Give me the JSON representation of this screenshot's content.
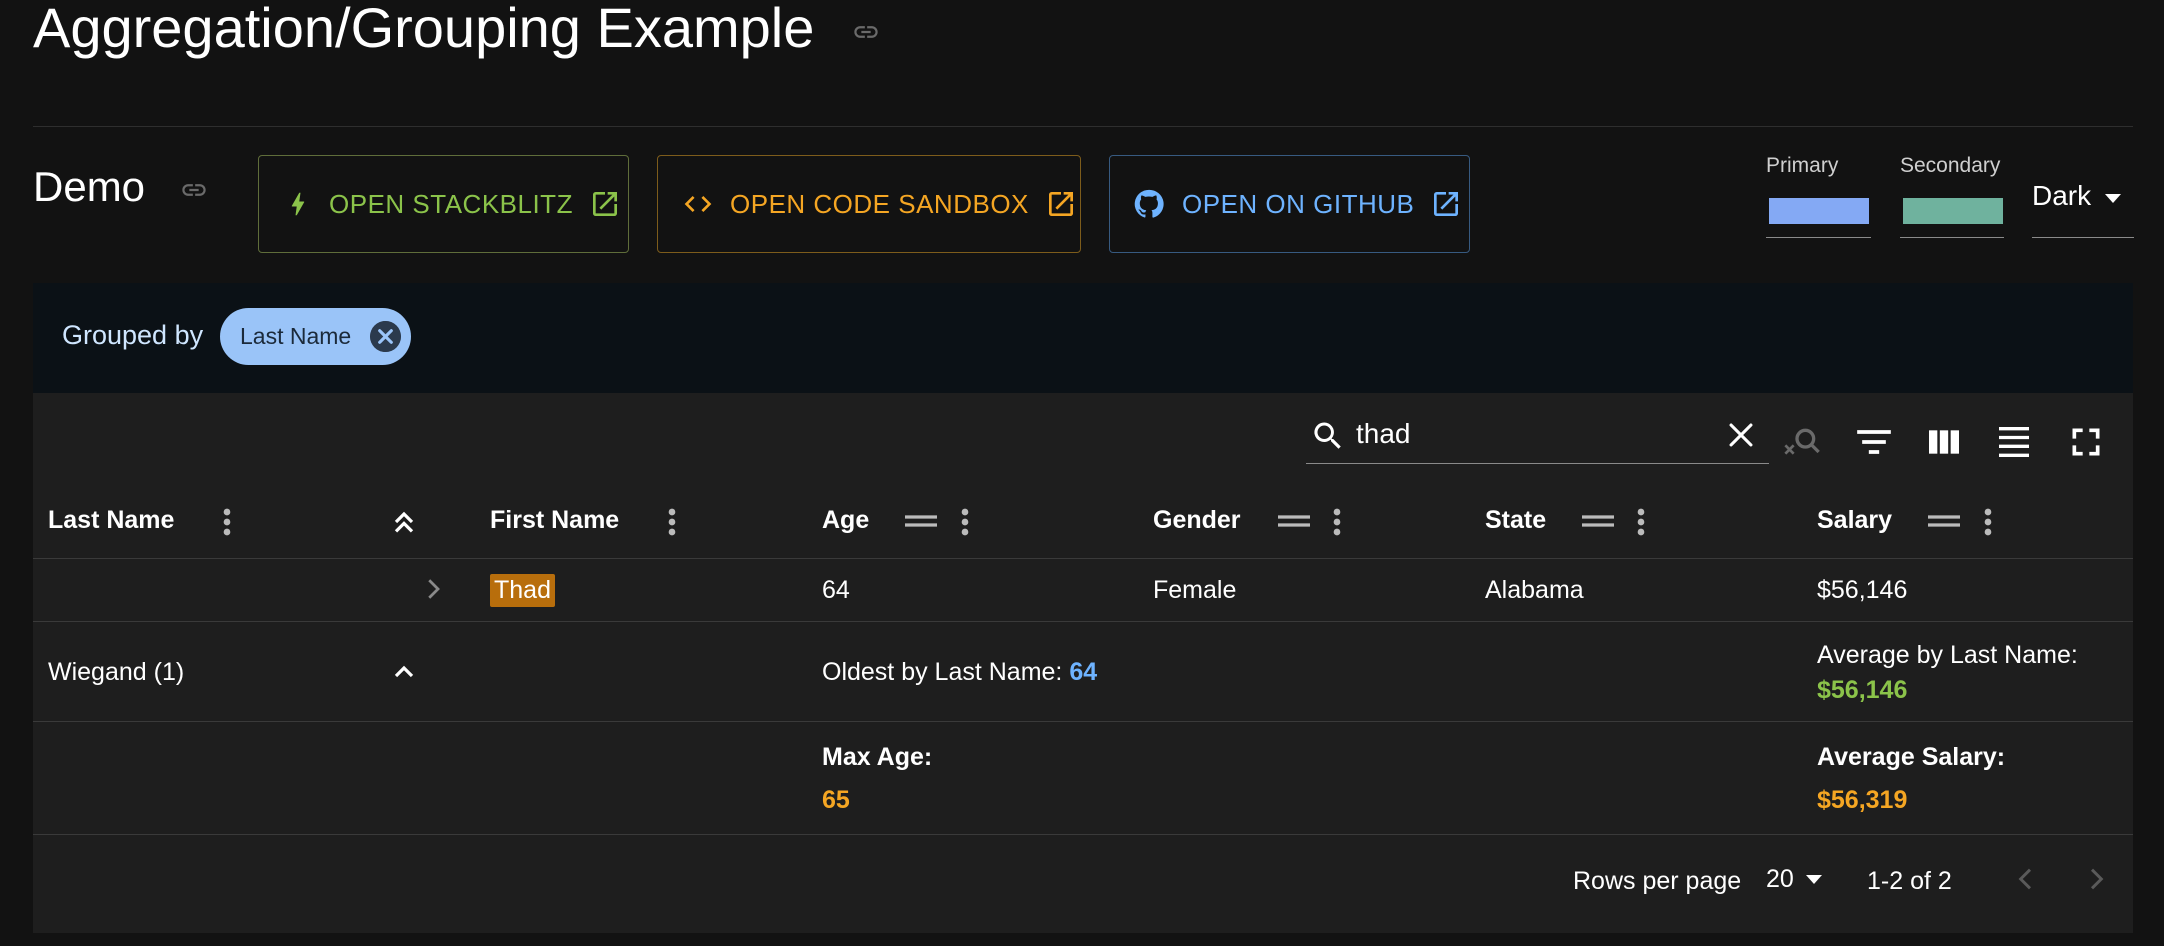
{
  "page": {
    "title": "Aggregation/Grouping Example",
    "demo_title": "Demo"
  },
  "buttons": {
    "stackblitz": "OPEN STACKBLITZ",
    "codesandbox": "OPEN CODE SANDBOX",
    "github": "OPEN ON GITHUB"
  },
  "theme": {
    "primary_label": "Primary",
    "primary_color": "#84a9f4",
    "secondary_label": "Secondary",
    "secondary_color": "#6fb29e",
    "mode": "Dark"
  },
  "grouping": {
    "label": "Grouped by",
    "chip": "Last Name"
  },
  "search": {
    "value": "thad",
    "placeholder": "Search"
  },
  "columns": {
    "last_name": "Last Name",
    "first_name": "First Name",
    "age": "Age",
    "gender": "Gender",
    "state": "State",
    "salary": "Salary"
  },
  "rows": {
    "detail": {
      "first_name": "Thad",
      "age": "64",
      "gender": "Female",
      "state": "Alabama",
      "salary": "$56,146"
    },
    "group": {
      "label": "Wiegand (1)",
      "oldest_label": "Oldest by Last Name:",
      "oldest_value": "64",
      "avg_label": "Average by Last Name:",
      "avg_value": "$56,146"
    }
  },
  "aggregates": {
    "max_age_label": "Max Age:",
    "max_age_value": "65",
    "avg_salary_label": "Average Salary:",
    "avg_salary_value": "$56,319"
  },
  "pagination": {
    "rows_per_page_label": "Rows per page",
    "rows_per_page": "20",
    "range": "1-2 of 2"
  },
  "colors": {
    "stackblitz": "#8bc34a",
    "codesandbox": "#f5a623",
    "github": "#6eb3ff",
    "highlight": "#b86e0c",
    "agg_blue": "#6eb3ff",
    "agg_green": "#8bc34a",
    "agg_orange": "#f5a623"
  }
}
